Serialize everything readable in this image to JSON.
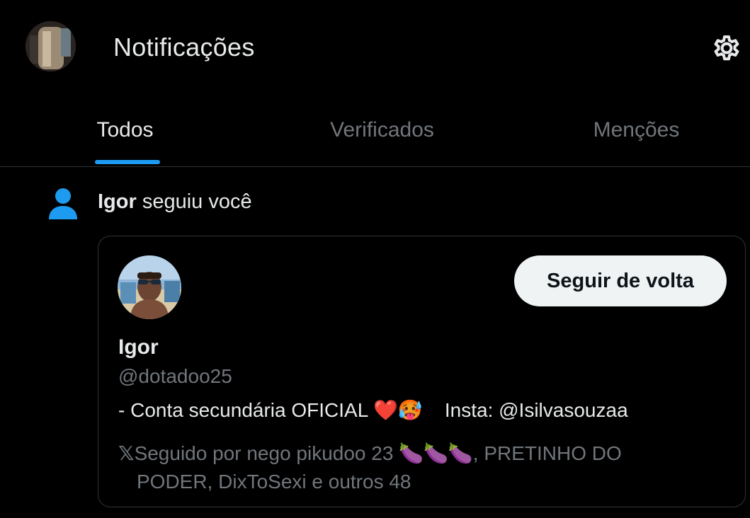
{
  "header": {
    "title": "Notificações",
    "settings_icon": "gear-icon"
  },
  "tabs": [
    {
      "label": "Todos",
      "active": true
    },
    {
      "label": "Verificados",
      "active": false
    },
    {
      "label": "Menções",
      "active": false
    }
  ],
  "colors": {
    "accent": "#1d9bf0",
    "background": "#000000",
    "text_primary": "#e7e9ea",
    "text_secondary": "#71767b",
    "border": "#2f3336"
  },
  "notification": {
    "icon": "person-icon",
    "actor": "Igor",
    "action": " seguiu você",
    "card": {
      "name": "Igor",
      "handle": "@dotadoo25",
      "bio_prefix": "- Conta secundária OFICIAL ",
      "bio_emojis": "❤️🥵",
      "bio_suffix": "Insta: @Isilvasouzaa",
      "follow_back_label": "Seguir de volta",
      "followed_by_glyph": "𝕏",
      "followed_by_line1": "Seguido por nego pikudoo 23 🍆🍆🍆, PRETINHO DO",
      "followed_by_line2": "PODER, DixToSexi e outros 48"
    }
  }
}
